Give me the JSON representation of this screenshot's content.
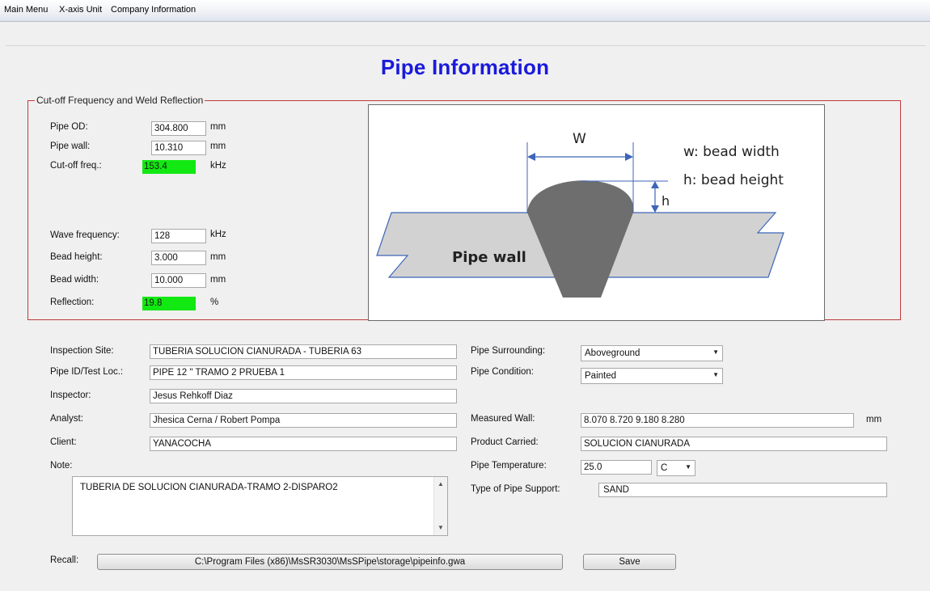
{
  "menu": {
    "items": [
      "Main Menu",
      "X-axis Unit",
      "Company Information"
    ]
  },
  "page_title": "Pipe Information",
  "cutoff_group": {
    "title": "Cut-off Frequency and Weld Reflection",
    "pipe_od": {
      "label": "Pipe OD:",
      "value": "304.800",
      "unit": "mm"
    },
    "pipe_wall": {
      "label": "Pipe wall:",
      "value": "10.310",
      "unit": "mm"
    },
    "cutoff_freq": {
      "label": "Cut-off freq.:",
      "value": "153.4",
      "unit": "kHz"
    },
    "wave_frequency": {
      "label": "Wave frequency:",
      "value": "128",
      "unit": "kHz"
    },
    "bead_height": {
      "label": "Bead height:",
      "value": "3.000",
      "unit": "mm"
    },
    "bead_width": {
      "label": "Bead width:",
      "value": "10.000",
      "unit": "mm"
    },
    "reflection": {
      "label": "Reflection:",
      "value": "19.8",
      "unit": "%"
    },
    "highlight_color": "#12e812"
  },
  "diagram": {
    "w_label": "W",
    "h_label": "h",
    "legend_w": "w: bead width",
    "legend_h": "h: bead height",
    "pipe_wall_label": "Pipe wall"
  },
  "inspection": {
    "site": {
      "label": "Inspection Site:",
      "value": "TUBERIA SOLUCION CIANURADA - TUBERIA 63"
    },
    "pipe_id": {
      "label": "Pipe ID/Test Loc.:",
      "value": "PIPE 12 \" TRAMO 2 PRUEBA 1"
    },
    "inspector": {
      "label": "Inspector:",
      "value": "Jesus Rehkoff Diaz"
    },
    "analyst": {
      "label": "Analyst:",
      "value": "Jhesica Cerna / Robert Pompa"
    },
    "client": {
      "label": "Client:",
      "value": "YANACOCHA"
    },
    "note": {
      "label": "Note:",
      "value": "TUBERIA DE SOLUCION CIANURADA-TRAMO 2-DISPARO2"
    }
  },
  "pipe_props": {
    "surrounding": {
      "label": "Pipe Surrounding:",
      "value": "Aboveground"
    },
    "condition": {
      "label": "Pipe Condition:",
      "value": "Painted"
    },
    "measured_wall": {
      "label": "Measured Wall:",
      "value": "8.070  8.720  9.180  8.280",
      "unit": "mm"
    },
    "product": {
      "label": "Product Carried:",
      "value": "SOLUCION CIANURADA"
    },
    "temperature": {
      "label": "Pipe Temperature:",
      "value": "25.0",
      "unit": "C"
    },
    "support": {
      "label": "Type of Pipe Support:",
      "value": "SAND"
    }
  },
  "recall": {
    "label": "Recall:",
    "path": "C:\\Program Files (x86)\\MsSR3030\\MsSPipe\\storage\\pipeinfo.gwa"
  },
  "save_label": "Save"
}
